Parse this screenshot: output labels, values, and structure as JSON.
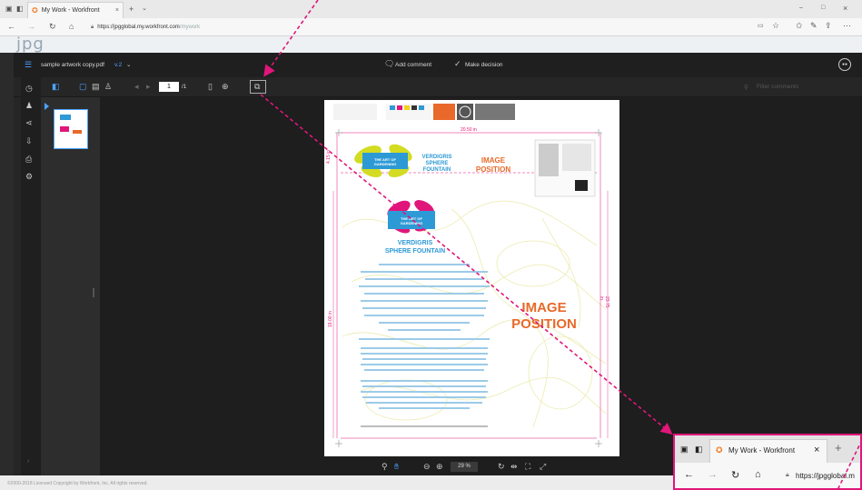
{
  "browser": {
    "tab_title": "My Work - Workfront",
    "new_tab": "+",
    "url_main": "https://jpgglobal.my.workfront.com",
    "url_path": "/mywork",
    "window_min": "–",
    "window_max": "□",
    "window_close": "×"
  },
  "app": {
    "logo": "jpg"
  },
  "viewer": {
    "doc_name": "sample artwork copy.pdf",
    "version": "v.2",
    "add_comment": "Add comment",
    "make_decision": "Make decision",
    "page_current": "1",
    "page_total": "/1",
    "filter_placeholder": "Filter comments",
    "zoom": "29 %"
  },
  "document": {
    "dimension_top": "20.50 in",
    "brand_top": "THE ART OF GARDENING",
    "brand_mid": "THE ART OF GARDENING",
    "product_1": "VERDIGRIS",
    "product_2": "SPHERE",
    "product_3": "FOUNTAIN",
    "product_full_1": "VERDIGRIS",
    "product_full_2": "SPHERE FOUNTAIN",
    "image_small_1": "IMAGE",
    "image_small_2": "POSITION",
    "image_big_1": "IMAGE",
    "image_big_2": "POSITION",
    "side_left_1": "4.15 in",
    "side_right": "23.75 in",
    "side_left_2": "19.00 in"
  },
  "inset": {
    "tab_title": "My Work - Workfront",
    "new_tab": "+",
    "url": "https://jpgglobal.m"
  },
  "footer": {
    "text": "©2000-2018 Licensed Copyright by Workfront, Inc. All rights reserved."
  },
  "colors": {
    "annotation": "#e0167a",
    "accent_blue": "#2d9ad6",
    "accent_orange": "#e8692a"
  }
}
